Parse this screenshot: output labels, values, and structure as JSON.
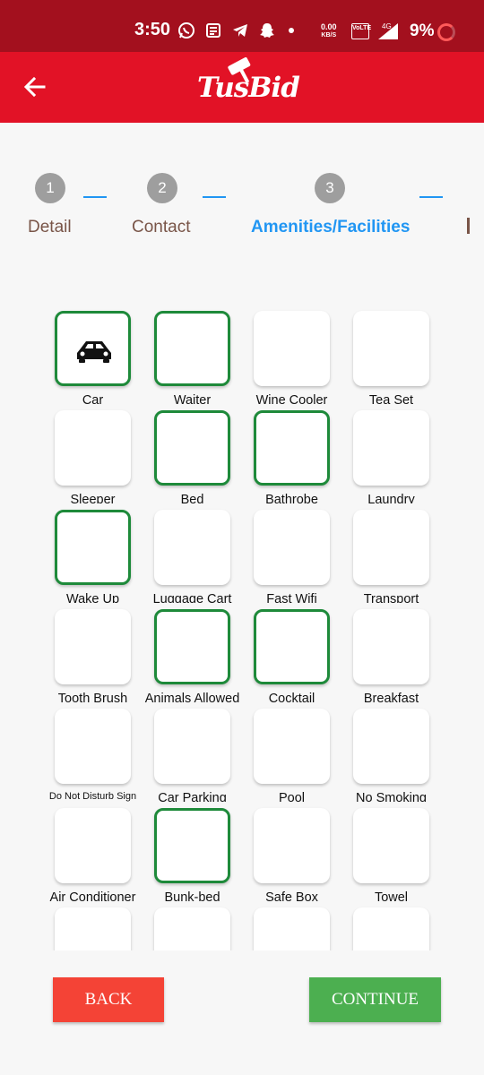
{
  "status_bar": {
    "time": "3:50",
    "net_speed_value": "0.00",
    "net_speed_unit": "KB/S",
    "volte": "VoLTE",
    "network_type": "4G",
    "battery": "9%"
  },
  "app_bar": {
    "logo_text": "TusBid"
  },
  "stepper": {
    "steps": [
      {
        "number": "1",
        "label": "Detail"
      },
      {
        "number": "2",
        "label": "Contact"
      },
      {
        "number": "3",
        "label": "Amenities/Facilities"
      }
    ],
    "active_step": 3
  },
  "amenities": [
    {
      "label": "Car",
      "selected": true,
      "icon": "car-icon"
    },
    {
      "label": "Waiter",
      "selected": true
    },
    {
      "label": "Wine Cooler",
      "selected": false
    },
    {
      "label": "Tea Set",
      "selected": false
    },
    {
      "label": "Sleeper",
      "selected": false
    },
    {
      "label": "Bed",
      "selected": true
    },
    {
      "label": "Bathrobe",
      "selected": true
    },
    {
      "label": "Laundry Machine",
      "selected": false
    },
    {
      "label": "Wake Up",
      "selected": true
    },
    {
      "label": "Luggage Cart",
      "selected": false
    },
    {
      "label": "Fast Wifi",
      "selected": false
    },
    {
      "label": "Transport",
      "selected": false
    },
    {
      "label": "Tooth Brush",
      "selected": false
    },
    {
      "label": "Animals Allowed",
      "selected": true
    },
    {
      "label": "Cocktail",
      "selected": true
    },
    {
      "label": "Breakfast",
      "selected": false
    },
    {
      "label": "Do Not Disturb Sign",
      "selected": false
    },
    {
      "label": "Car Parking",
      "selected": false
    },
    {
      "label": "Pool",
      "selected": false
    },
    {
      "label": "No Smoking",
      "selected": false
    },
    {
      "label": "Air Conditioner",
      "selected": false
    },
    {
      "label": "Bunk-bed",
      "selected": true
    },
    {
      "label": "Safe Box",
      "selected": false
    },
    {
      "label": "Towel",
      "selected": false
    },
    {
      "label": "",
      "selected": false
    },
    {
      "label": "",
      "selected": false
    },
    {
      "label": "",
      "selected": false
    },
    {
      "label": "",
      "selected": false
    }
  ],
  "buttons": {
    "back": "BACK",
    "continue": "CONTINUE"
  },
  "colors": {
    "status_bar": "#a3101e",
    "app_bar": "#e21226",
    "active_step": "#2196f3",
    "selected_border": "#1e8a3a",
    "back_button": "#f44336",
    "continue_button": "#4caf50"
  }
}
